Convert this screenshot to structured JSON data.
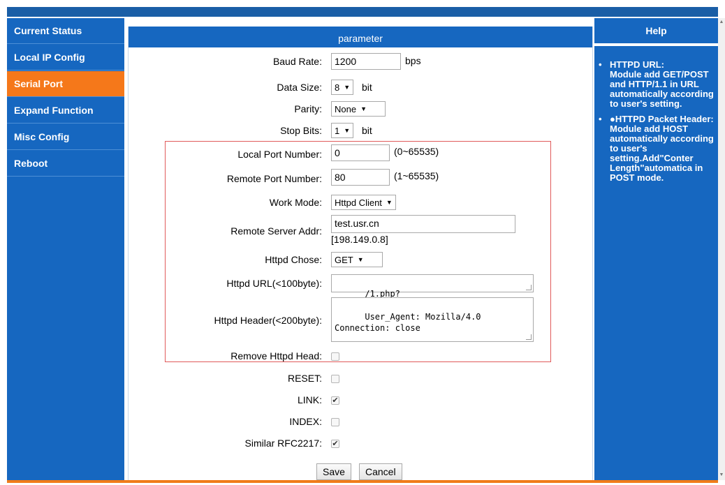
{
  "sidebar": {
    "items": [
      {
        "label": "Current Status"
      },
      {
        "label": "Local IP Config"
      },
      {
        "label": "Serial Port",
        "active": true
      },
      {
        "label": "Expand Function"
      },
      {
        "label": "Misc Config"
      },
      {
        "label": "Reboot"
      }
    ]
  },
  "main": {
    "header": "parameter",
    "baud_rate": {
      "label": "Baud Rate:",
      "value": "1200",
      "unit": "bps"
    },
    "data_size": {
      "label": "Data Size:",
      "value": "8",
      "unit": "bit"
    },
    "parity": {
      "label": "Parity:",
      "value": "None"
    },
    "stop_bits": {
      "label": "Stop Bits:",
      "value": "1",
      "unit": "bit"
    },
    "local_port": {
      "label": "Local Port Number:",
      "value": "0",
      "range": "(0~65535)"
    },
    "remote_port": {
      "label": "Remote Port Number:",
      "value": "80",
      "range": "(1~65535)"
    },
    "work_mode": {
      "label": "Work Mode:",
      "value": "Httpd Client"
    },
    "remote_server": {
      "label": "Remote Server Addr:",
      "value": "test.usr.cn",
      "resolved": "[198.149.0.8]"
    },
    "httpd_chose": {
      "label": "Httpd Chose:",
      "value": "GET"
    },
    "httpd_url": {
      "label": "Httpd URL(<100byte):",
      "value": "/1.php?"
    },
    "httpd_header": {
      "label": "Httpd Header(<200byte):",
      "value": "User_Agent: Mozilla/4.0\nConnection: close"
    },
    "remove_httpd_head": {
      "label": "Remove Httpd Head:",
      "checked": false
    },
    "reset": {
      "label": "RESET:",
      "checked": false
    },
    "link": {
      "label": "LINK:",
      "checked": true
    },
    "index": {
      "label": "INDEX:",
      "checked": false
    },
    "similar_rfc2217": {
      "label": "Similar RFC2217:",
      "checked": true
    },
    "save_label": "Save",
    "cancel_label": "Cancel"
  },
  "help": {
    "title": "Help",
    "items": [
      {
        "heading": "HTTPD URL:",
        "body": "Module add GET/POST and HTTP/1.1 in URL automatically according to user's setting."
      },
      {
        "heading": "●HTTPD Packet Header:",
        "body": "Module add HOST automatically according to user's setting.Add\"Conter Length\"automatica in POST mode."
      }
    ]
  },
  "colors": {
    "primary": "#1667c0",
    "accent": "#f5781a",
    "highlight_border": "#e05a5a"
  },
  "icons": {
    "select_arrow": "▼",
    "check": "✔",
    "bullet": "•"
  }
}
